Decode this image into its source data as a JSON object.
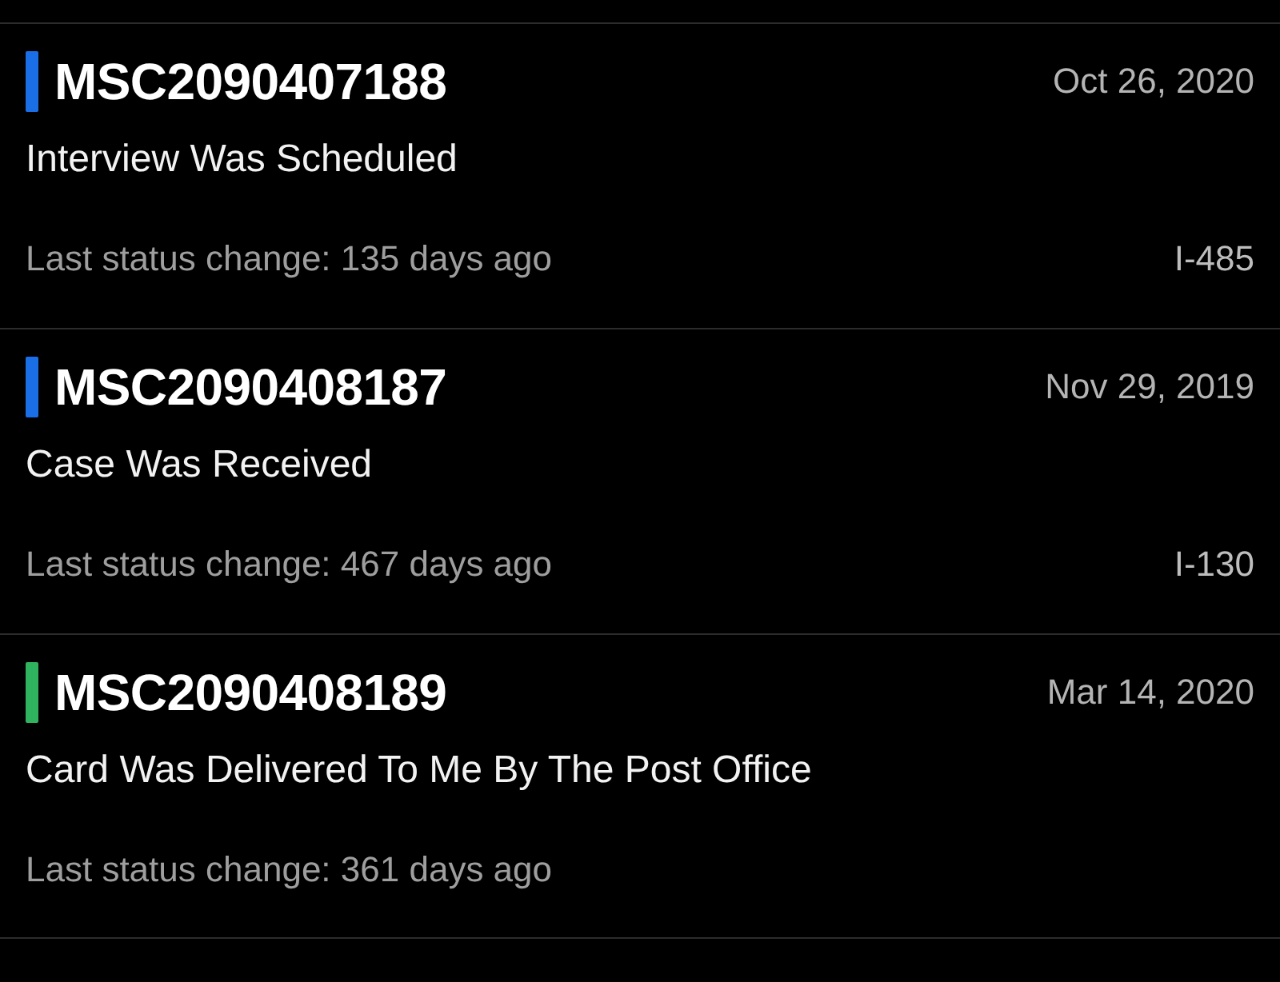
{
  "cases": [
    {
      "receipt": "MSC2090407188",
      "color": "#1b6fe6",
      "date": "Oct 26, 2020",
      "status": "Interview Was Scheduled",
      "last_change": "Last status change: 135 days ago",
      "form": "I-485"
    },
    {
      "receipt": "MSC2090408187",
      "color": "#1b6fe6",
      "date": "Nov 29, 2019",
      "status": "Case Was Received",
      "last_change": "Last status change: 467 days ago",
      "form": "I-130"
    },
    {
      "receipt": "MSC2090408189",
      "color": "#2fb35e",
      "date": "Mar 14, 2020",
      "status": "Card Was Delivered To Me By The Post Office",
      "last_change": "Last status change: 361 days ago"
    }
  ]
}
